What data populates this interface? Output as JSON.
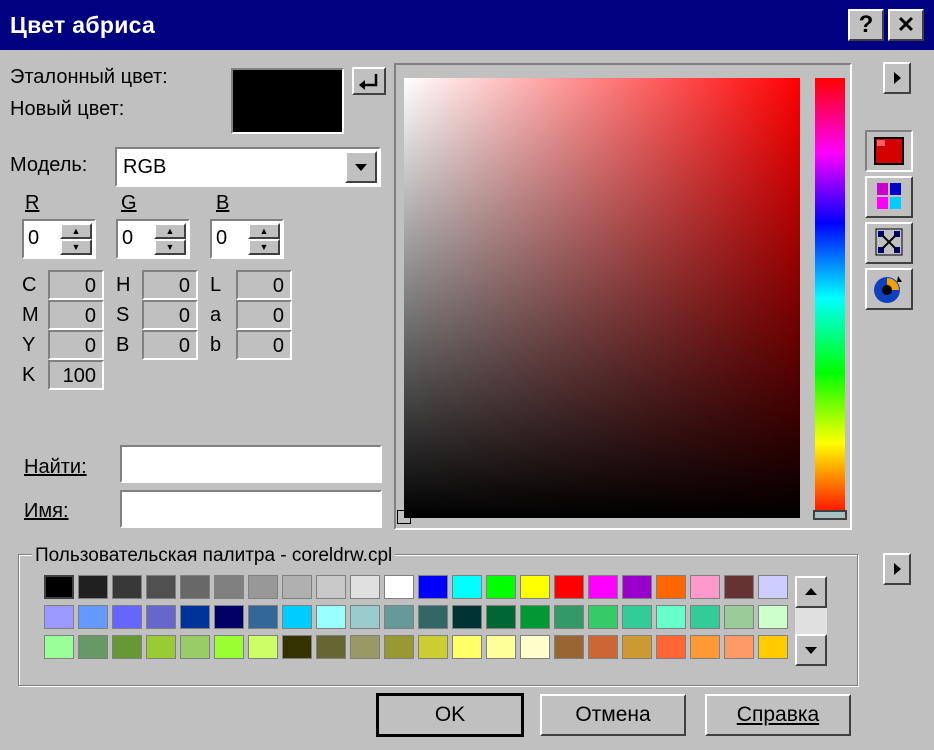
{
  "window": {
    "title": "Цвет абриса",
    "help_btn": "?",
    "close_btn": "✕"
  },
  "labels": {
    "reference_color": "Эталонный цвет:",
    "new_color": "Новый цвет:",
    "model": "Модель:"
  },
  "model": {
    "selected": "RGB"
  },
  "rgb": [
    {
      "label": "R",
      "value": "0"
    },
    {
      "label": "G",
      "value": "0"
    },
    {
      "label": "B",
      "value": "0"
    }
  ],
  "cmyk": [
    {
      "label": "C",
      "value": "0"
    },
    {
      "label": "M",
      "value": "0"
    },
    {
      "label": "Y",
      "value": "0"
    },
    {
      "label": "K",
      "value": "100"
    }
  ],
  "hsb": [
    {
      "label": "H",
      "value": "0"
    },
    {
      "label": "S",
      "value": "0"
    },
    {
      "label": "B",
      "value": "0"
    }
  ],
  "lab": [
    {
      "label": "L",
      "value": "0"
    },
    {
      "label": "a",
      "value": "0"
    },
    {
      "label": "b",
      "value": "0"
    }
  ],
  "search": {
    "find_label": "Найти:",
    "find_value": "",
    "name_label": "Имя:",
    "name_value": ""
  },
  "palette": {
    "title": "Пользовательская палитра - coreldrw.cpl",
    "rows": [
      [
        "#000000",
        "#202020",
        "#383838",
        "#505050",
        "#686868",
        "#808080",
        "#989898",
        "#b0b0b0",
        "#c8c8c8",
        "#e0e0e0",
        "#ffffff",
        "#0000ff",
        "#00ffff",
        "#00ff00",
        "#ffff00",
        "#ff0000",
        "#ff00ff",
        "#9900cc",
        "#ff6600",
        "#ff99cc",
        "#663333",
        "#ccccff"
      ],
      [
        "#9999ff",
        "#6699ff",
        "#6666ff",
        "#6666cc",
        "#003399",
        "#000066",
        "#336699",
        "#00ccff",
        "#99ffff",
        "#99cccc",
        "#669999",
        "#336666",
        "#003333",
        "#006633",
        "#009933",
        "#339966",
        "#33cc66",
        "#33cc99",
        "#66ffcc",
        "#33cc99",
        "#99cc99",
        "#ccffcc"
      ],
      [
        "#99ff99",
        "#669966",
        "#669933",
        "#99cc33",
        "#99cc66",
        "#99ff33",
        "#ccff66",
        "#333300",
        "#666633",
        "#999966",
        "#999933",
        "#cccc33",
        "#ffff66",
        "#ffff99",
        "#ffffcc",
        "#996633",
        "#cc6633",
        "#cc9933",
        "#ff6633",
        "#ff9933",
        "#ff9966",
        "#ffcc00"
      ]
    ]
  },
  "buttons": {
    "ok": "OK",
    "cancel": "Отмена",
    "help": "Справка"
  },
  "colors": {
    "title_bg": "#000080",
    "dialog_bg": "#c0c0c0",
    "current_hue": "#ff0000",
    "preview": "#000000"
  },
  "icons": [
    "undo-arrow-icon",
    "expand-arrow-icon",
    "color-model-icon",
    "palettes-icon",
    "mixers-icon",
    "color-harmony-icon",
    "scroll-up-icon",
    "scroll-down-icon",
    "dropdown-arrow-icon"
  ]
}
